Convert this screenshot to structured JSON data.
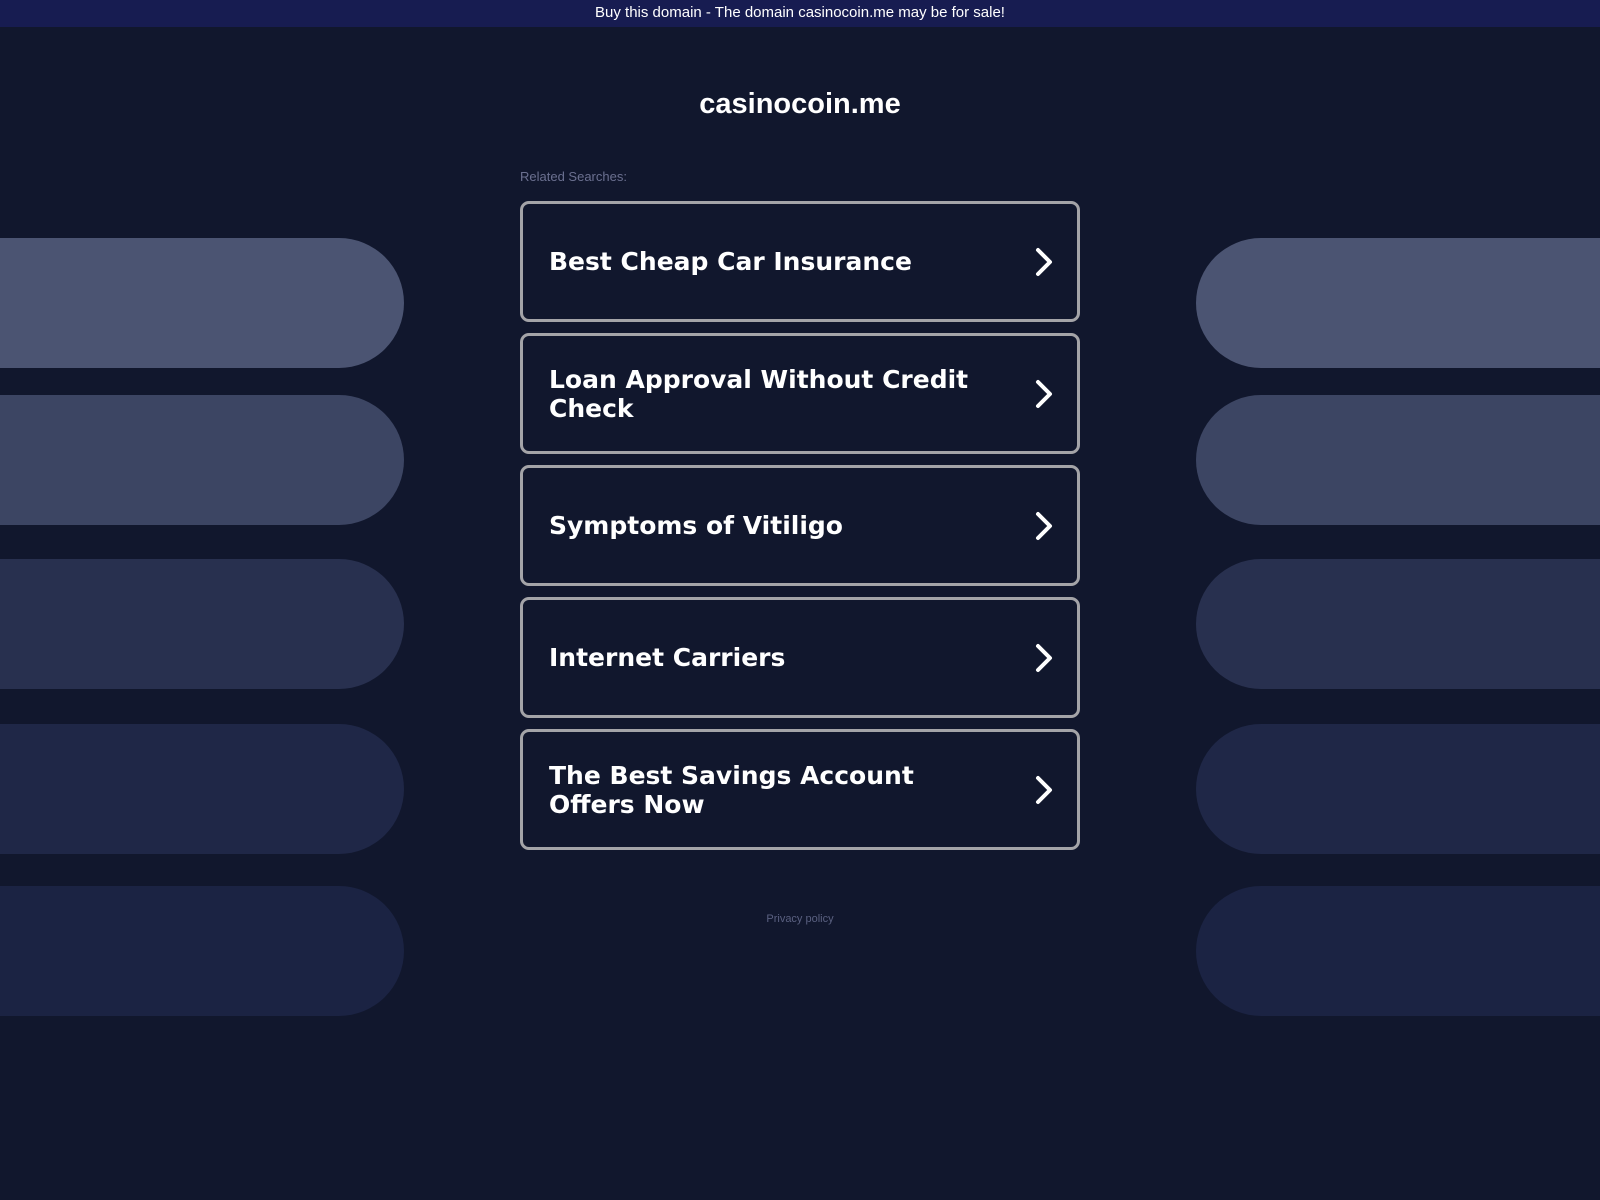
{
  "banner": {
    "text": "Buy this domain - The domain casinocoin.me may be for sale!"
  },
  "header": {
    "domain": "casinocoin.me"
  },
  "related": {
    "label": "Related Searches:",
    "items": [
      {
        "label": "Best Cheap Car Insurance"
      },
      {
        "label": "Loan Approval Without Credit Check"
      },
      {
        "label": "Symptoms of Vitiligo"
      },
      {
        "label": "Internet Carriers"
      },
      {
        "label": "The Best Savings Account Offers Now"
      }
    ]
  },
  "footer": {
    "privacy_label": "Privacy policy"
  },
  "icons": {
    "chevron": "chevron-right-icon"
  },
  "colors": {
    "background": "#11172d",
    "banner_background": "#171c51",
    "card_border": "#a4a4a8",
    "text": "#ffffff"
  }
}
